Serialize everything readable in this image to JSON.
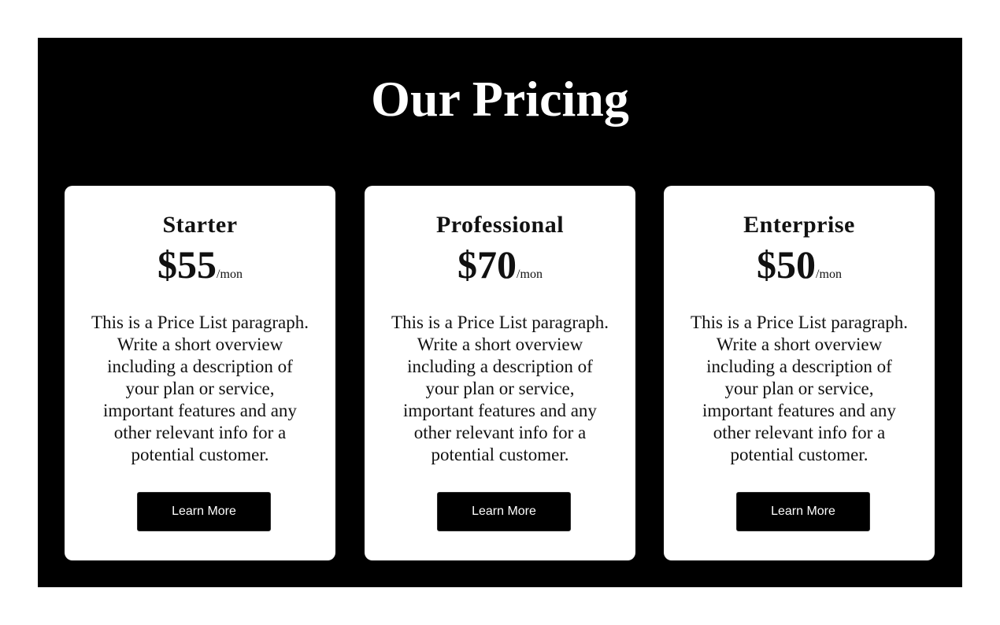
{
  "section": {
    "title": "Our Pricing"
  },
  "plans": [
    {
      "name": "Starter",
      "price": "$55",
      "period": "/mon",
      "description": "This is a Price List paragraph. Write a short overview including a description of your plan or service, important features and any other relevant info for a potential customer.",
      "button_label": "Learn More"
    },
    {
      "name": "Professional",
      "price": "$70",
      "period": "/mon",
      "description": "This is a Price List paragraph. Write a short overview including a description of your plan or service, important features and any other relevant info for a potential customer.",
      "button_label": "Learn More"
    },
    {
      "name": "Enterprise",
      "price": "$50",
      "period": "/mon",
      "description": "This is a Price List paragraph. Write a short overview including a description of your plan or service, important features and any other relevant info for a potential customer.",
      "button_label": "Learn More"
    }
  ],
  "colors": {
    "section_background": "#000000",
    "card_background": "#ffffff",
    "button_background": "#000000",
    "button_text": "#ffffff",
    "title_text": "#ffffff"
  }
}
